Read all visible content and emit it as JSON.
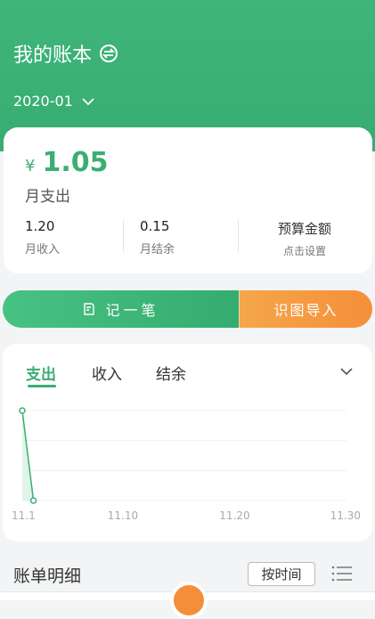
{
  "header": {
    "book_title": "我的账本",
    "month": "2020-01"
  },
  "summary": {
    "currency": "¥",
    "expense_amount": "1.05",
    "expense_label": "月支出",
    "income_value": "1.20",
    "income_label": "月收入",
    "balance_value": "0.15",
    "balance_label": "月结余",
    "budget_title": "预算金额",
    "budget_hint": "点击设置"
  },
  "actions": {
    "record_label": "记一笔",
    "import_label": "识图导入"
  },
  "chart_tabs": {
    "expense": "支出",
    "income": "收入",
    "balance": "结余"
  },
  "chart_data": {
    "type": "line",
    "x": [
      "11.1",
      "11.2"
    ],
    "series": [
      {
        "values": [
          1.0,
          0.0
        ]
      }
    ],
    "x_tick_labels": [
      "11.1",
      "11.10",
      "11.20",
      "11.30"
    ],
    "ylim": [
      0,
      1
    ]
  },
  "details": {
    "title": "账单明细",
    "sort_label": "按时间"
  },
  "colors": {
    "brand_green": "#3aae73",
    "accent_orange": "#f58f3a"
  }
}
